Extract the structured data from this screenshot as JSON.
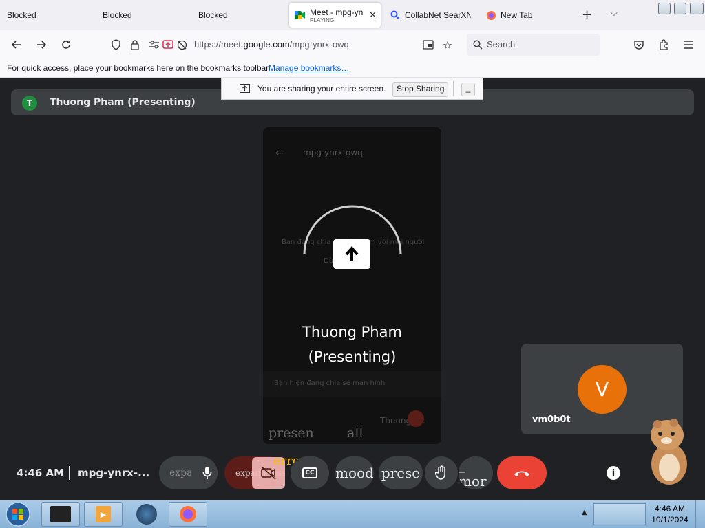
{
  "browser": {
    "tabs": [
      {
        "title": "Blocked"
      },
      {
        "title": "Blocked"
      },
      {
        "title": "Blocked"
      },
      {
        "title": "Meet - mpg-yn",
        "subtitle": "PLAYING",
        "active": true
      },
      {
        "title": "CollabNet SearXN"
      },
      {
        "title": "New Tab"
      }
    ],
    "url_prefix": "https://meet.",
    "url_domain": "google.com",
    "url_path": "/mpg-ynrx-owq",
    "search_placeholder": "Search",
    "bookmarks_hint": "For quick access, place your bookmarks here on the bookmarks toolbar.",
    "bookmarks_link": "Manage bookmarks…"
  },
  "sharing": {
    "notice": "You are sharing your entire screen.",
    "stop_label": "Stop Sharing",
    "minimize_label": "_"
  },
  "meet": {
    "presenter_initial": "T",
    "presenter_bar_label": "Thuong Pham (Presenting)",
    "presenter_name_line1": "Thuong Pham",
    "presenter_name_line2": "(Presenting)",
    "phone": {
      "meeting_code": "mpg-ynrx-owq",
      "faded_line1": "Bạn đang chia sẻ màn hình với mọi người",
      "faded_line2": "Dừng chia sẻ",
      "banner": "Bạn hiện đang chia sẻ màn hình",
      "tile_name": "Thuong P..."
    },
    "self": {
      "initial": "V",
      "name": "vm0b0t"
    },
    "time": "4:46 AM",
    "meeting_id": "mpg-ynrx-...",
    "broken_labels": {
      "expand_1": "expa",
      "expand_2": "expand_less",
      "error": "error",
      "mood": "mood",
      "present": "prese",
      "more": "_ mor",
      "present_all": "presen",
      "all": "all"
    },
    "colors": {
      "meet_bg": "#202124",
      "tile_bg": "#3c4043",
      "hangup_red": "#ea4335",
      "avatar_orange": "#e8710a",
      "presenter_green": "#1e8e3e"
    }
  },
  "taskbar": {
    "clock_time": "4:46 AM",
    "clock_date": "10/1/2024"
  }
}
